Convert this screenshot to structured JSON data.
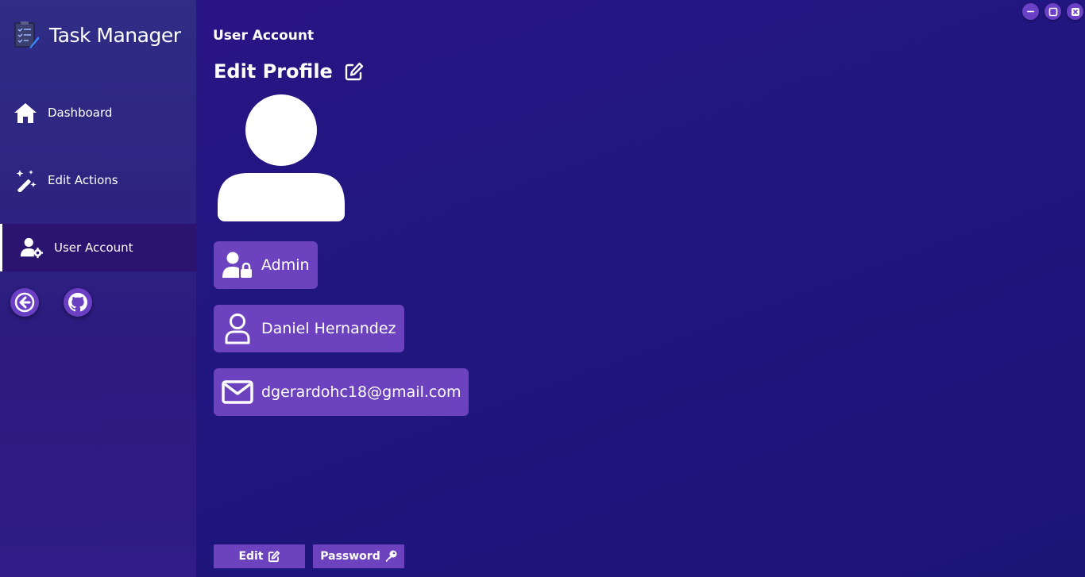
{
  "app": {
    "title": "Task Manager"
  },
  "sidebar": {
    "items": [
      {
        "label": "Dashboard",
        "icon": "home-icon"
      },
      {
        "label": "Edit Actions",
        "icon": "magic-wand-icon"
      },
      {
        "label": "User Account",
        "icon": "user-gear-icon",
        "active": true
      }
    ],
    "round_buttons": [
      {
        "icon": "back-arrow-icon"
      },
      {
        "icon": "github-icon"
      }
    ]
  },
  "window_controls": [
    "minimize-icon",
    "maximize-icon",
    "close-icon"
  ],
  "main": {
    "page_title": "User Account",
    "edit_heading": "Edit Profile",
    "role": "Admin",
    "name": "Daniel Hernandez",
    "email": "dgerardohc18@gmail.com"
  },
  "buttons": {
    "edit_label": "Edit",
    "password_label": "Password"
  },
  "colors": {
    "background": "#211680",
    "sidebar": "#2e2480",
    "active_item": "#2a1470",
    "accent": "#6c42bf",
    "text": "#ffffff"
  }
}
